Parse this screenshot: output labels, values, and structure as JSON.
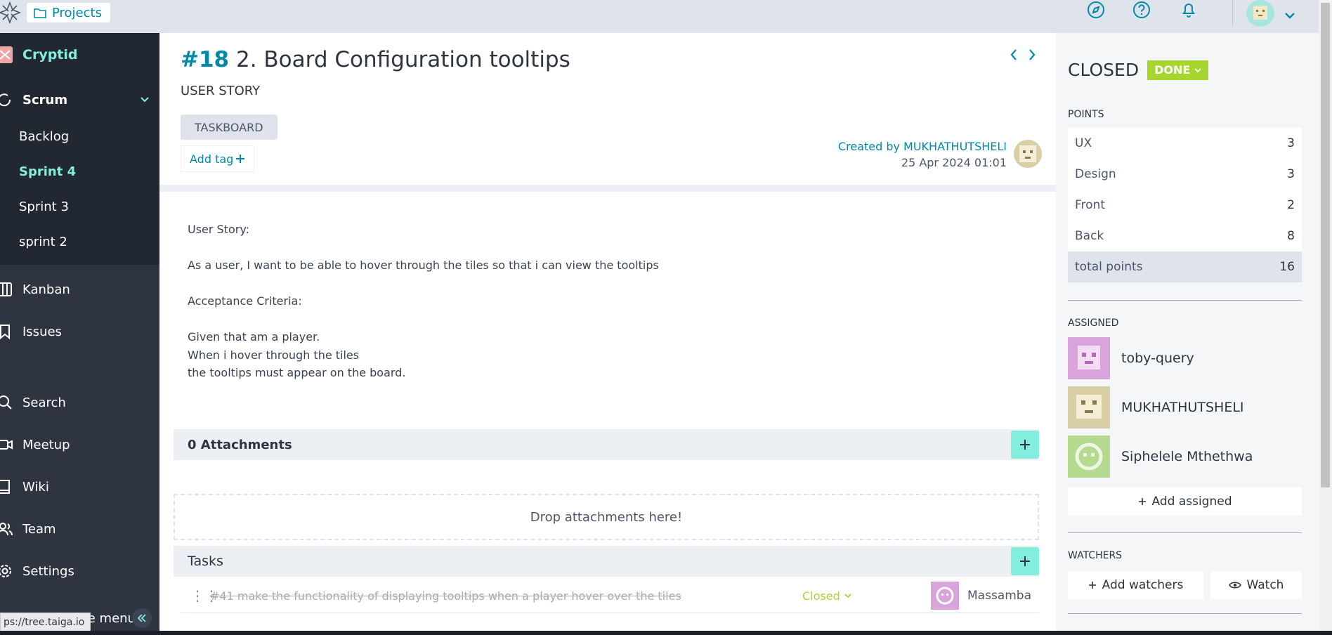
{
  "topbar": {
    "projects_label": "Projects"
  },
  "sidebar": {
    "project_name": "Cryptid",
    "scrum_label": "Scrum",
    "sprints": [
      {
        "label": "Backlog"
      },
      {
        "label": "Sprint 4"
      },
      {
        "label": "Sprint 3"
      },
      {
        "label": "sprint 2"
      }
    ],
    "kanban_label": "Kanban",
    "issues_label": "Issues",
    "search_label": "Search",
    "meetup_label": "Meetup",
    "wiki_label": "Wiki",
    "team_label": "Team",
    "settings_label": "Settings",
    "collapse_label": "collapse menu",
    "status_url": "ps://tree.taiga.io"
  },
  "story": {
    "ref": "#18",
    "title": "2. Board Configuration tooltips",
    "type_label": "USER STORY",
    "tag": "TASKBOARD",
    "add_tag_label": "Add tag",
    "created_by": "Created by MUKHATHUTSHELI",
    "created_date": "25 Apr 2024 01:01",
    "description": [
      "User Story:",
      "",
      "As a user, I   want to be able to hover through the tiles so that i can view the tooltips",
      "",
      "Acceptance Criteria:",
      "",
      "Given that am a player.",
      "When i hover through the tiles",
      "the tooltips must appear  on the board."
    ]
  },
  "attachments": {
    "header": "0 Attachments",
    "drop_text": "Drop attachments here!"
  },
  "tasks": {
    "header": "Tasks",
    "items": [
      {
        "ref": "#41",
        "name": "make the functionality of displaying tooltips when a player hover over the tiles",
        "status": "Closed",
        "assignee": "Massamba"
      }
    ]
  },
  "panel": {
    "status": "CLOSED",
    "badge": "DONE",
    "points_label": "POINTS",
    "points": [
      {
        "role": "UX",
        "value": "3"
      },
      {
        "role": "Design",
        "value": "3"
      },
      {
        "role": "Front",
        "value": "2"
      },
      {
        "role": "Back",
        "value": "8"
      }
    ],
    "total_label": "total points",
    "total_value": "16",
    "assigned_label": "ASSIGNED",
    "assigned": [
      {
        "name": "toby-query"
      },
      {
        "name": "MUKHATHUTSHELI"
      },
      {
        "name": "Siphelele Mthethwa"
      }
    ],
    "add_assigned_label": "Add assigned",
    "watchers_label": "WATCHERS",
    "add_watchers_label": "Add watchers",
    "watch_label": "Watch"
  },
  "colors": {
    "accent": "#008aa8",
    "mint": "#83eede",
    "done": "#a7d530",
    "sidebar": "#2e3440"
  }
}
